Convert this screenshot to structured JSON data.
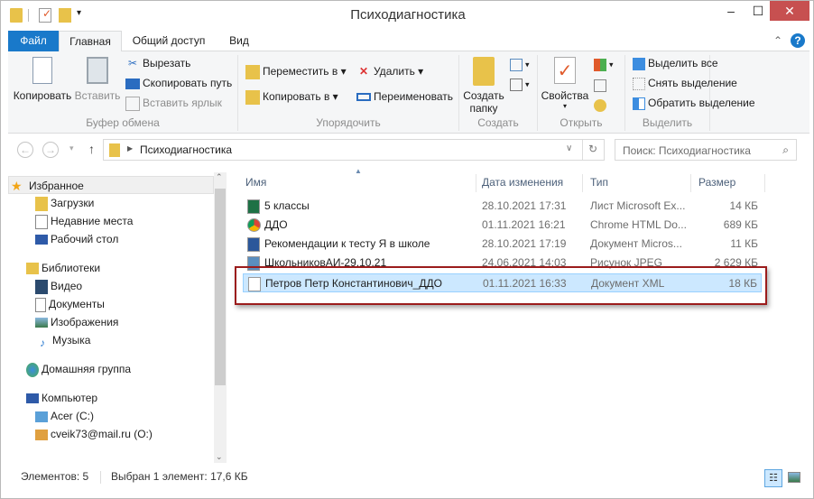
{
  "window": {
    "title": "Психодиагностика",
    "minimize": "–",
    "maximize": "☐",
    "close": "✕"
  },
  "tabs": [
    {
      "label": "Файл"
    },
    {
      "label": "Главная"
    },
    {
      "label": "Общий доступ"
    },
    {
      "label": "Вид"
    }
  ],
  "ribbon": {
    "clipboard": {
      "label": "Буфер обмена",
      "copy": "Копировать",
      "paste": "Вставить",
      "cut": "Вырезать",
      "copy_path": "Скопировать путь",
      "paste_shortcut": "Вставить ярлык"
    },
    "organize": {
      "label": "Упорядочить",
      "move_to": "Переместить в",
      "copy_to": "Копировать в",
      "delete": "Удалить",
      "rename": "Переименовать"
    },
    "new": {
      "label": "Создать",
      "new_folder_line1": "Создать",
      "new_folder_line2": "папку"
    },
    "open": {
      "label": "Открыть",
      "properties": "Свойства"
    },
    "select": {
      "label": "Выделить",
      "select_all": "Выделить все",
      "select_none": "Снять выделение",
      "invert": "Обратить выделение"
    }
  },
  "address": {
    "path": "Психодиагностика",
    "search_placeholder": "Поиск: Психодиагностика"
  },
  "nav": {
    "favorites": "Избранное",
    "downloads": "Загрузки",
    "recent": "Недавние места",
    "desktop": "Рабочий стол",
    "libraries": "Библиотеки",
    "video": "Видео",
    "documents": "Документы",
    "pictures": "Изображения",
    "music": "Музыка",
    "homegroup": "Домашняя группа",
    "computer": "Компьютер",
    "drive_c": "Acer (C:)",
    "drive_o": "cveik73@mail.ru (O:)"
  },
  "columns": {
    "name": "Имя",
    "date": "Дата изменения",
    "type": "Тип",
    "size": "Размер"
  },
  "files": [
    {
      "name": "5 классы",
      "date": "28.10.2021 17:31",
      "type": "Лист Microsoft Ex...",
      "size": "14 КБ",
      "icon": "excel-icon",
      "color": "#1e7145"
    },
    {
      "name": "ДДО",
      "date": "01.11.2021 16:21",
      "type": "Chrome HTML Do...",
      "size": "689 КБ",
      "icon": "chrome-icon",
      "color": "#db4437"
    },
    {
      "name": "Рекомендации к тесту Я в школе",
      "date": "28.10.2021 17:19",
      "type": "Документ Micros...",
      "size": "11 КБ",
      "icon": "word-icon",
      "color": "#2b579a"
    },
    {
      "name": "ШкольниковАИ-29.10.21",
      "date": "24.06.2021 14:03",
      "type": "Рисунок JPEG",
      "size": "2 629 КБ",
      "icon": "image-icon",
      "color": "#5b8fbf"
    },
    {
      "name": "Петров Петр Константинович_ДДО",
      "date": "01.11.2021 16:33",
      "type": "Документ XML",
      "size": "18 КБ",
      "icon": "xml-file-icon",
      "color": "#ffffff"
    }
  ],
  "status": {
    "count": "Элементов: 5",
    "selected": "Выбран 1 элемент: 17,6 КБ"
  },
  "colors": {
    "accent": "#1979ca",
    "close": "#c75050",
    "selection": "#cce8ff",
    "highlight": "#9b1c1c"
  }
}
